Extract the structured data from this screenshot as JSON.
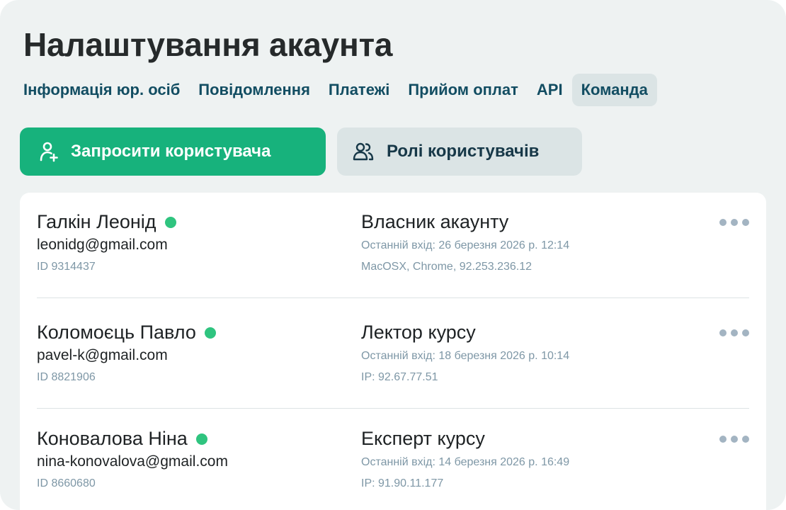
{
  "page": {
    "title": "Налаштування акаунта"
  },
  "tabs": [
    {
      "label": "Інформація юр. осіб"
    },
    {
      "label": "Повідомлення"
    },
    {
      "label": "Платежі"
    },
    {
      "label": "Прийом оплат"
    },
    {
      "label": "API"
    },
    {
      "label": "Команда",
      "active": true
    }
  ],
  "actions": {
    "invite": {
      "label": "Запросити користувача",
      "icon": "user-plus-icon"
    },
    "roles": {
      "label": "Ролі користувачів",
      "icon": "users-icon"
    }
  },
  "users": [
    {
      "name": "Галкін Леонід",
      "email": "leonidg@gmail.com",
      "id": "ID 9314437",
      "role": "Власник акаунту",
      "last_login": "Останній вхід: 26 березня 2026 р. 12:14",
      "device": "MacOSX, Chrome, 92.253.236.12"
    },
    {
      "name": "Коломоєць Павло",
      "email": "pavel-k@gmail.com",
      "id": "ID 8821906",
      "role": "Лектор курсу",
      "last_login": "Останній вхід: 18 березня 2026 р. 10:14",
      "device": "IP: 92.67.77.51"
    },
    {
      "name": "Коновалова Ніна",
      "email": "nina-konovalova@gmail.com",
      "id": "ID 8660680",
      "role": "Експерт курсу",
      "last_login": "Останній вхід: 14 березня 2026 р. 16:49",
      "device": "IP: 91.90.11.177"
    }
  ],
  "colors": {
    "background": "#eef2f2",
    "accent": "#17b27c",
    "online": "#2fc47f",
    "tab_text": "#124d62",
    "muted": "#7e97a6"
  }
}
